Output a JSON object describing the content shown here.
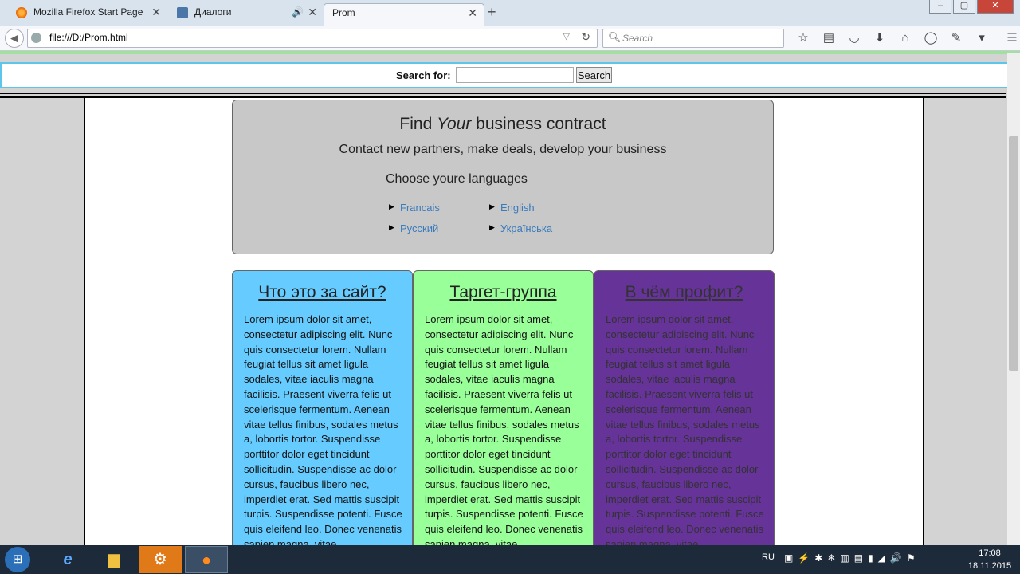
{
  "browser": {
    "tabs": [
      {
        "title": "Mozilla Firefox Start Page",
        "favicon": "firefox-icon"
      },
      {
        "title": "Диалоги",
        "favicon": "vk-icon",
        "audio": true
      },
      {
        "title": "Prom",
        "favicon": "",
        "active": true
      }
    ],
    "url": "file:///D:/Prom.html",
    "search_placeholder": "Search"
  },
  "page": {
    "search_label": "Search for:",
    "search_button": "Search",
    "hero": {
      "title_pre": "Find ",
      "title_em": "Your",
      "title_post": " business contract",
      "subtitle": "Contact new partners, make deals, develop your business",
      "languages_heading": "Choose youre languages",
      "languages": [
        "Francais",
        "English",
        "Русский",
        "Українська"
      ]
    },
    "columns": [
      {
        "title": "Что это за сайт?",
        "color": "#66ccff"
      },
      {
        "title": "Таргет-группа",
        "color": "#99ff99"
      },
      {
        "title": "В чём профит?",
        "color": "#663399"
      }
    ],
    "column_text": "Lorem ipsum dolor sit amet, consectetur adipiscing elit. Nunc quis consectetur lorem. Nullam feugiat tellus sit amet ligula sodales, vitae iaculis magna facilisis. Praesent viverra felis ut scelerisque fermentum. Aenean vitae tellus finibus, sodales metus a, lobortis tortor. Suspendisse porttitor dolor eget tincidunt sollicitudin. Suspendisse ac dolor cursus, faucibus libero nec, imperdiet erat. Sed mattis suscipit turpis. Suspendisse potenti. Fusce quis eleifend leo. Donec venenatis sapien magna, vitae"
  },
  "taskbar": {
    "language": "RU",
    "time": "17:08",
    "date": "18.11.2015"
  }
}
